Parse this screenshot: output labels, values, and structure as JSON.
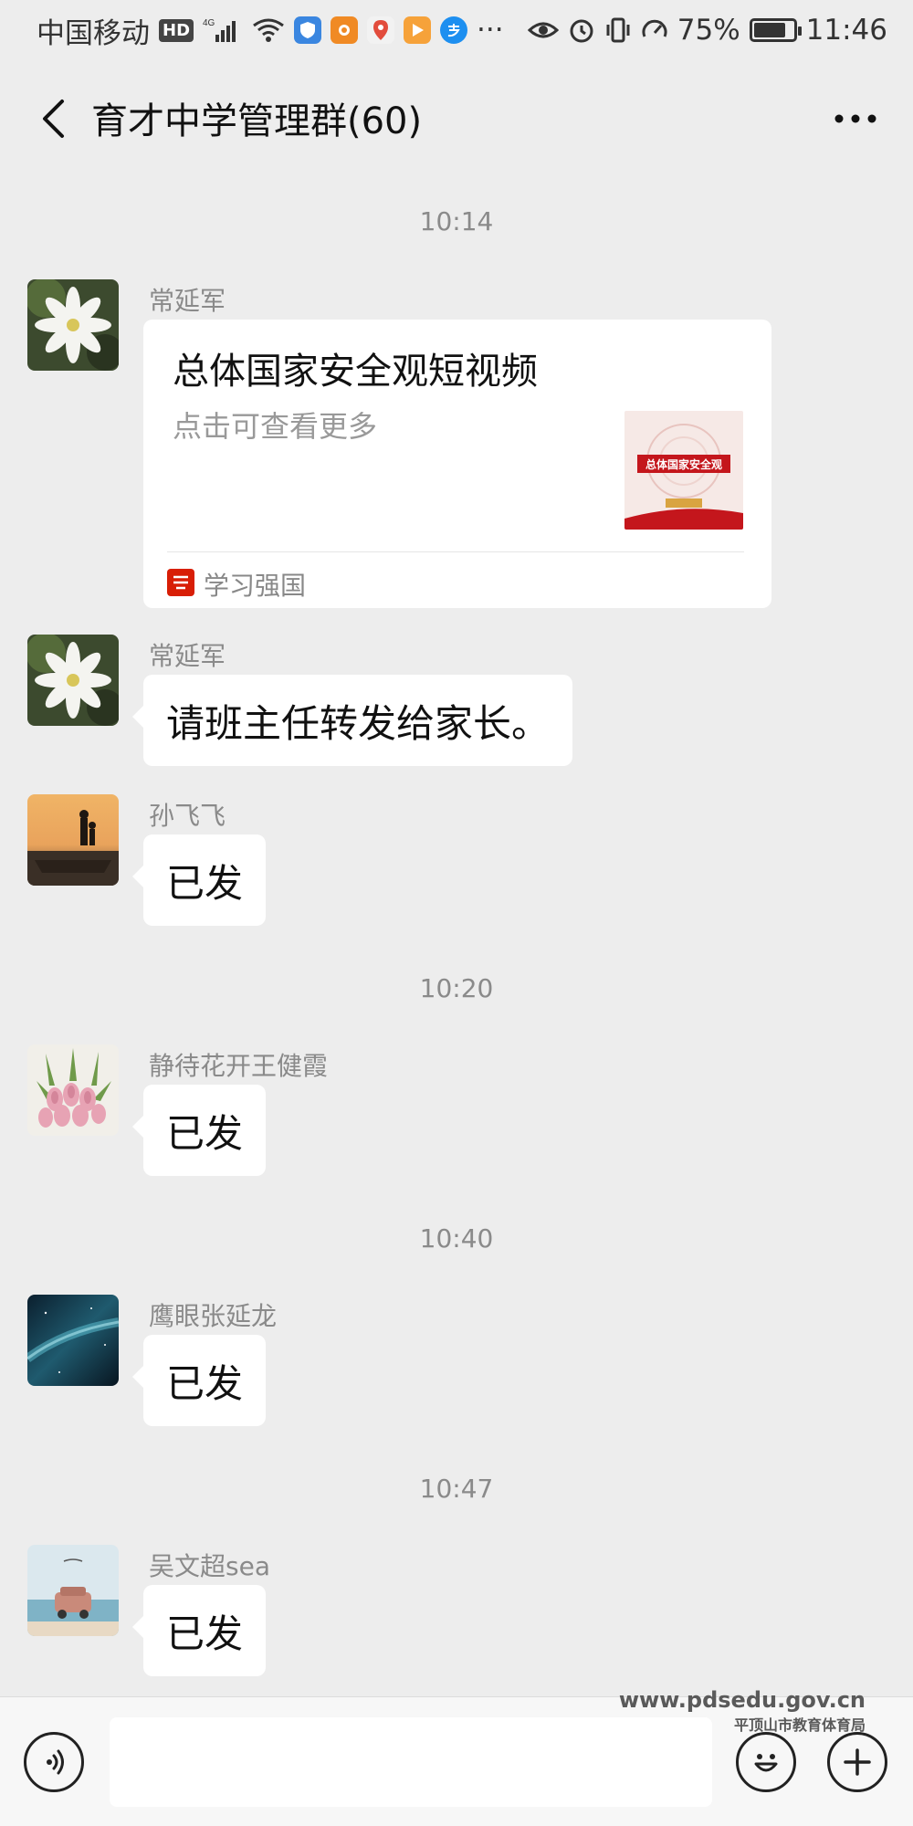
{
  "status_bar": {
    "carrier": "中国移动",
    "hd": "HD",
    "network": "4G",
    "battery": "75%",
    "time": "11:46",
    "more": "···"
  },
  "nav": {
    "title": "育才中学管理群(60)"
  },
  "messages": [
    {
      "type": "time",
      "text": "10:14"
    },
    {
      "type": "card",
      "sender": "常延军",
      "card": {
        "title": "总体国家安全观短视频",
        "desc": "点击可查看更多",
        "thumb_text": "总体国家安全观",
        "source": "学习强国"
      }
    },
    {
      "type": "text",
      "sender": "常延军",
      "text": "请班主任转发给家长。"
    },
    {
      "type": "text",
      "sender": "孙飞飞",
      "text": "已发"
    },
    {
      "type": "time",
      "text": "10:20"
    },
    {
      "type": "text",
      "sender": "静待花开王健霞",
      "text": "已发"
    },
    {
      "type": "time",
      "text": "10:40"
    },
    {
      "type": "text",
      "sender": "鹰眼张延龙",
      "text": "已发"
    },
    {
      "type": "time",
      "text": "10:47"
    },
    {
      "type": "text",
      "sender": "吴文超sea",
      "text": "已发"
    }
  ],
  "input": {
    "value": "",
    "placeholder": ""
  },
  "watermark": {
    "url": "www.pdsedu.gov.cn",
    "org": "平顶山市教育体育局"
  },
  "colors": {
    "background": "#ededed",
    "bubble": "#ffffff",
    "meta_text": "#8a8a8a",
    "source_logo": "#d81e06"
  }
}
